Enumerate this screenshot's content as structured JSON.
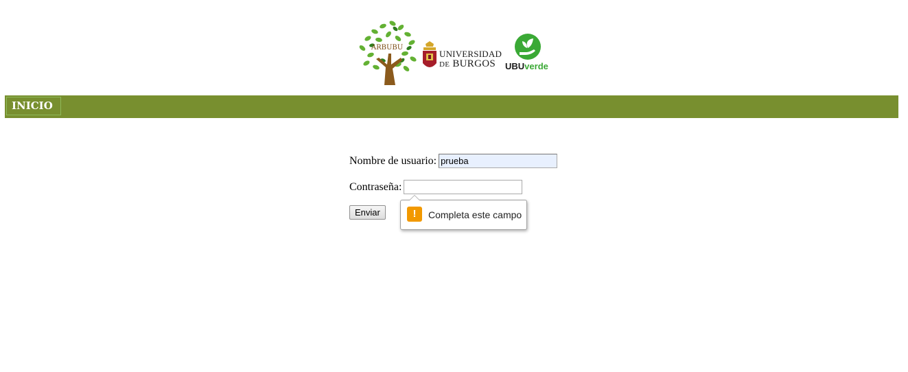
{
  "header": {
    "logos": [
      {
        "name": "arbubu-logo",
        "text": "ARBUBU"
      },
      {
        "name": "universidad-burgos-logo",
        "line1": "UNIVERSIDAD",
        "line2_small": "DE",
        "line2": "BURGOS"
      },
      {
        "name": "ubuverde-logo",
        "text_a": "UBU",
        "text_b": "verde"
      }
    ]
  },
  "nav": {
    "items": [
      {
        "label": "INICIO"
      }
    ],
    "color": "#788f2f"
  },
  "form": {
    "username_label": "Nombre de usuario:",
    "username_value": "prueba",
    "password_label": "Contraseña:",
    "password_value": "",
    "submit_label": "Enviar"
  },
  "validation": {
    "message": "Completa este campo",
    "icon": "warning-icon",
    "icon_glyph": "!",
    "icon_color": "#f29900"
  }
}
